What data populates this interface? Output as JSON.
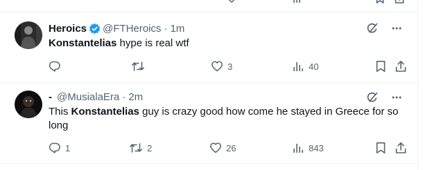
{
  "tweets": [
    {
      "display_name": "Heroics",
      "verified": true,
      "handle": "@FTHeroics",
      "time": "1m",
      "text_prefix": "",
      "text_bold": "Konstantelias",
      "text_suffix": " hype is real wtf",
      "stats": {
        "replies": "",
        "retweets": "",
        "likes": "3",
        "views": "40"
      }
    },
    {
      "display_name": "-",
      "verified": false,
      "handle": "@MusialaEra",
      "time": "2m",
      "text_prefix": "This ",
      "text_bold": "Konstantelias",
      "text_suffix": " guy is crazy good how come he stayed in Greece for so long",
      "stats": {
        "replies": "1",
        "retweets": "2",
        "likes": "26",
        "views": "843"
      }
    }
  ],
  "icons": {
    "verified": "verified-badge-icon",
    "grok": "grok-icon",
    "more": "more-icon",
    "reply": "reply-icon",
    "retweet": "retweet-icon",
    "like": "like-icon",
    "views": "views-icon",
    "bookmark": "bookmark-icon",
    "share": "share-icon"
  },
  "colors": {
    "text": "#0f1419",
    "muted": "#536471",
    "verified": "#1d9bf0",
    "divider": "#eff3f4"
  }
}
